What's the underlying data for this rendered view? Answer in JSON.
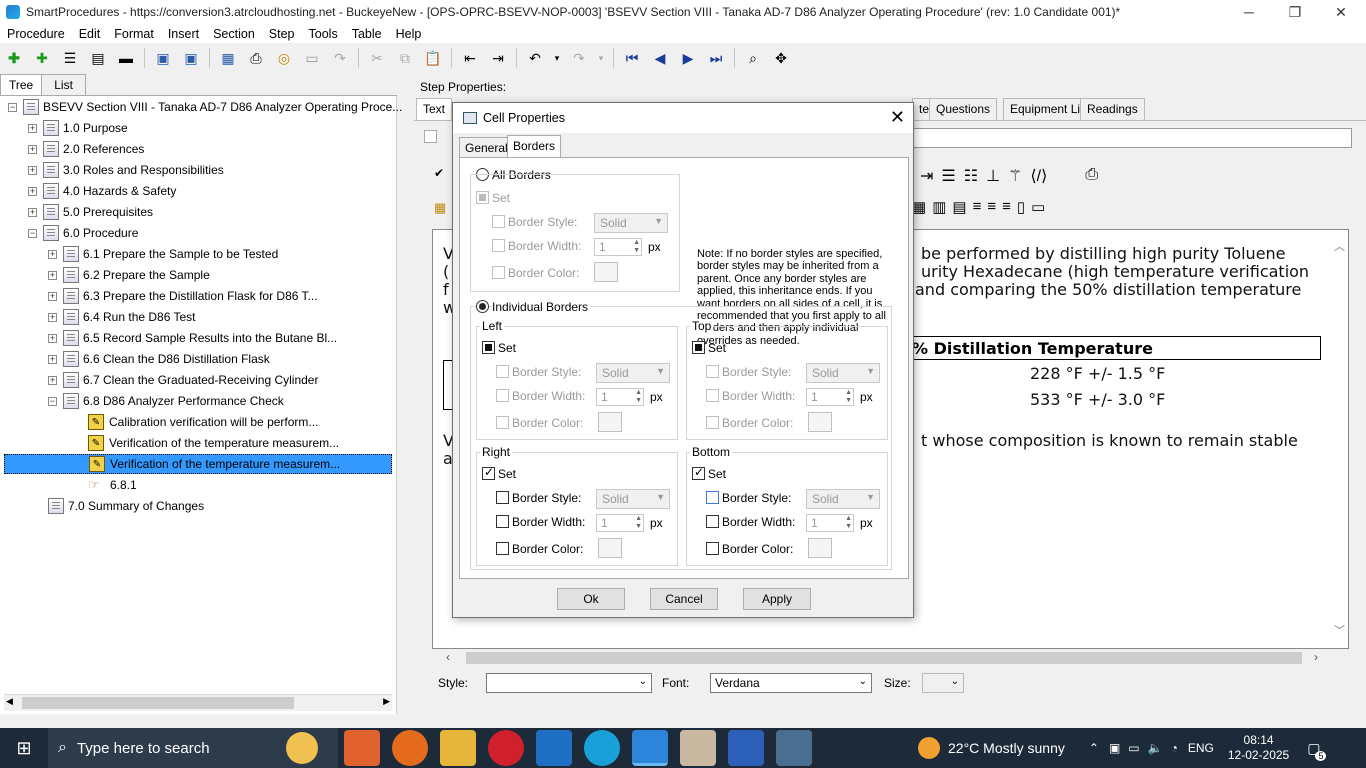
{
  "window": {
    "title": "SmartProcedures - https://conversion3.atrcloudhosting.net - BuckeyeNew - [OPS-OPRC-BSEVV-NOP-0003] 'BSEVV Section VIII - Tanaka AD-7 D86 Analyzer Operating Procedure' (rev: 1.0 Candidate 001)*",
    "minimize": "─",
    "restore": "❐",
    "close": "✕"
  },
  "menu": [
    "Procedure",
    "Edit",
    "Format",
    "Insert",
    "Section",
    "Step",
    "Tools",
    "Table",
    "Help"
  ],
  "left_tabs": [
    "Tree",
    "List"
  ],
  "tree": {
    "root": "BSEVV Section VIII - Tanaka AD-7 D86 Analyzer Operating Proce...",
    "items": [
      {
        "label": "1.0 Purpose"
      },
      {
        "label": "2.0 References"
      },
      {
        "label": "3.0 Roles and Responsibilities"
      },
      {
        "label": "4.0 Hazards & Safety"
      },
      {
        "label": "5.0 Prerequisites"
      },
      {
        "label": "6.0 Procedure"
      },
      {
        "label": "6.1 Prepare the Sample to be Tested"
      },
      {
        "label": "6.2 Prepare the Sample"
      },
      {
        "label": "6.3 Prepare the Distillation Flask for D86 T..."
      },
      {
        "label": "6.4 Run the D86 Test"
      },
      {
        "label": "6.5 Record Sample Results into the Butane Bl..."
      },
      {
        "label": "6.6 Clean the D86 Distillation Flask"
      },
      {
        "label": "6.7 Clean the Graduated-Receiving Cylinder"
      },
      {
        "label": "6.8 D86 Analyzer Performance Check"
      },
      {
        "label": "Calibration verification will be perform..."
      },
      {
        "label": "Verification of the temperature measurem..."
      },
      {
        "label": "Verification of the temperature measurem..."
      },
      {
        "label": "6.8.1"
      },
      {
        "label": "7.0 Summary of Changes"
      }
    ]
  },
  "step_properties_label": "Step Properties:",
  "right_tabs": {
    "text": "Text",
    "te": "te",
    "questions": "Questions",
    "equipment": "Equipment Limits",
    "readings": "Readings"
  },
  "content": {
    "line1": "be performed by distilling high purity Toluene",
    "line2": "urity Hexadecane (high temperature verification",
    "line3": "and comparing the 50% distillation temperature",
    "table_header": "% Distillation Temperature",
    "row1": "228 °F +/- 1.5 °F",
    "row2": "533 °F +/- 3.0 °F",
    "line4": "t whose composition is known to remain stable",
    "frag_v": "V",
    "frag_paren": "(",
    "frag_f": "f",
    "frag_w": "w",
    "frag_v2": "V",
    "frag_a": "a"
  },
  "stylebar": {
    "style_label": "Style:",
    "style_value": "",
    "font_label": "Font:",
    "font_value": "Verdana",
    "size_label": "Size:",
    "size_value": ""
  },
  "dialog": {
    "title": "Cell Properties",
    "tabs": [
      "General",
      "Borders"
    ],
    "all_borders": "All Borders",
    "set": "Set",
    "border_style": "Border Style:",
    "border_width": "Border Width:",
    "border_color": "Border Color:",
    "style_value": "Solid",
    "width_value": "1",
    "px": "px",
    "note": "Note: If no border styles are specified, border styles may be inherited from a parent.  Once any border styles are applied, this inheritance ends.  If you want borders on all sides of a cell, it is recommended that you first apply to all borders and then apply individual overrides as needed.",
    "individual_borders": "Individual Borders",
    "groups": {
      "left": "Left",
      "top": "Top",
      "right": "Right",
      "bottom": "Bottom"
    },
    "buttons": {
      "ok": "Ok",
      "cancel": "Cancel",
      "apply": "Apply"
    }
  },
  "taskbar": {
    "search_placeholder": "Type here to search",
    "weather": "22°C  Mostly sunny",
    "lang": "ENG",
    "time": "08:14",
    "date": "12-02-2025",
    "notif": "5"
  },
  "colors": {
    "selection": "#3399ff",
    "taskbar": "#1c2a3a",
    "accent": "#0078d7"
  }
}
